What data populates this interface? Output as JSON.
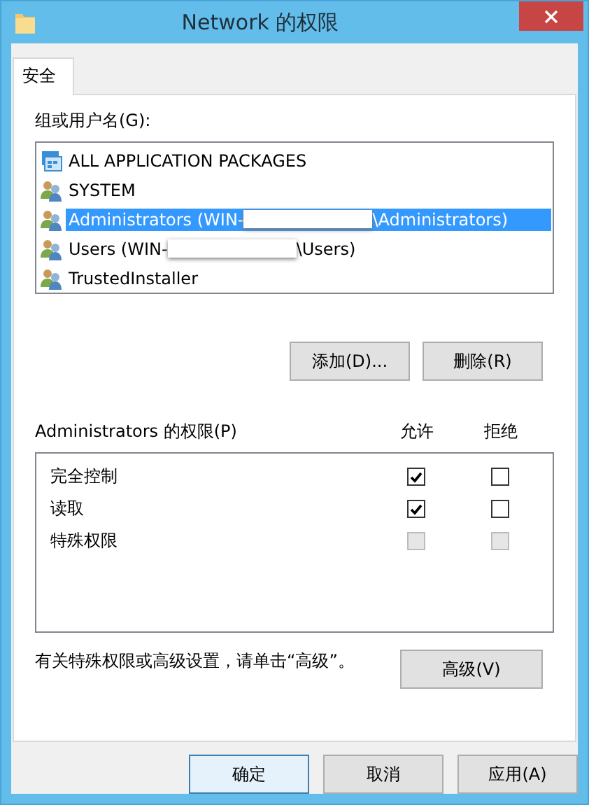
{
  "window": {
    "title": "Network 的权限"
  },
  "tabs": [
    {
      "label": "安全",
      "selected": true
    }
  ],
  "group_label": "组或用户名(G):",
  "users": [
    {
      "kind": "package",
      "name": "ALL APPLICATION PACKAGES",
      "selected": false
    },
    {
      "kind": "group",
      "name": "SYSTEM",
      "selected": false
    },
    {
      "kind": "group",
      "name": "Administrators (WIN-",
      "name_end": "\\Administrators)",
      "redacted": true,
      "selected": true
    },
    {
      "kind": "group",
      "name": "Users (WIN-",
      "name_end": "\\Users)",
      "redacted": true,
      "selected": false
    },
    {
      "kind": "group",
      "name": "TrustedInstaller",
      "selected": false
    }
  ],
  "user_buttons": [
    "添加(D)...",
    "删除(R)"
  ],
  "permissions": {
    "label": "Administrators 的权限(P)",
    "allow_header": "允许",
    "deny_header": "拒绝",
    "rows": [
      {
        "name": "完全控制",
        "allow": true,
        "allow_disabled": false,
        "deny": false,
        "deny_disabled": false
      },
      {
        "name": "读取",
        "allow": true,
        "allow_disabled": false,
        "deny": false,
        "deny_disabled": false
      },
      {
        "name": "特殊权限",
        "allow": false,
        "allow_disabled": true,
        "deny": false,
        "deny_disabled": true
      }
    ]
  },
  "advanced_hint": "有关特殊权限或高级设置，请单击“高级”。",
  "advanced_button": "高级(V)",
  "buttons": [
    {
      "label": "确定",
      "default": true
    },
    {
      "label": "取消",
      "default": false
    },
    {
      "label": "应用(A)",
      "default": false
    }
  ]
}
